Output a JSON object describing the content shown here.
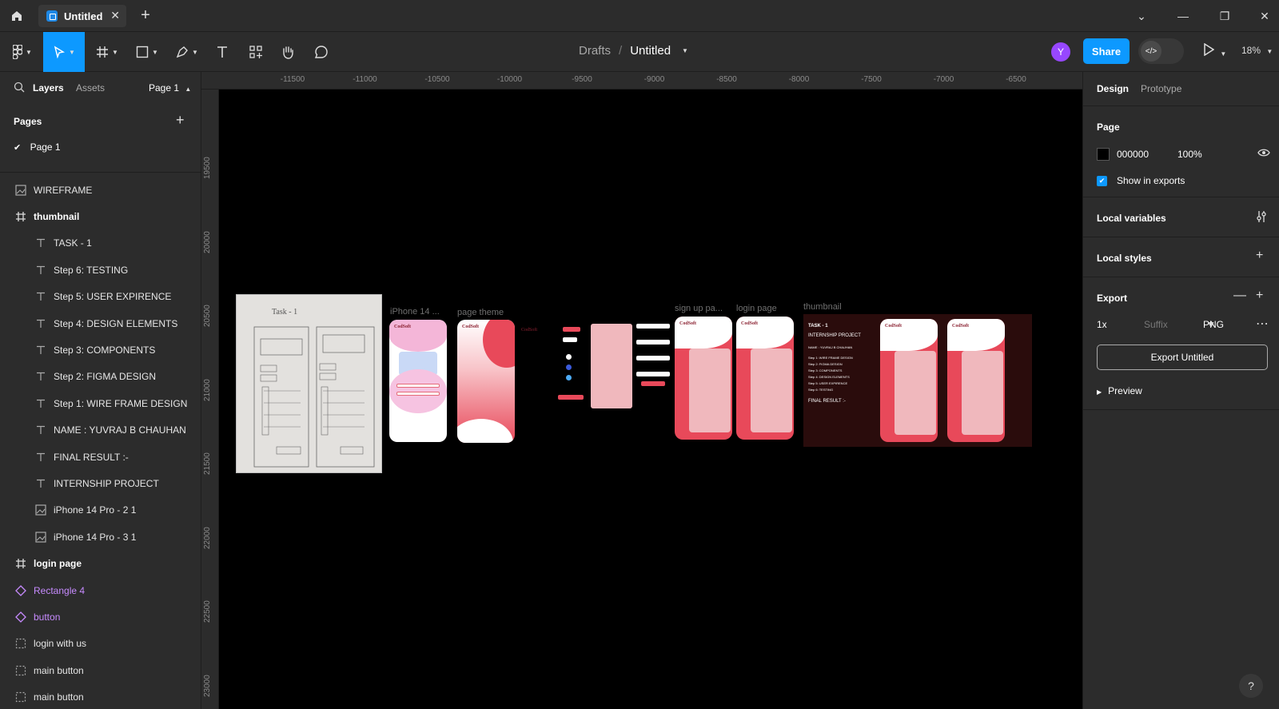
{
  "window": {
    "tab_title": "Untitled",
    "tab_close": "✕",
    "new_tab": "+",
    "controls": [
      "⌄",
      "—",
      "❐",
      "✕"
    ]
  },
  "toolbar": {
    "breadcrumb_parent": "Drafts",
    "breadcrumb_sep": "/",
    "file_name": "Untitled",
    "avatar_letter": "Y",
    "share_label": "Share",
    "zoom_label": "18%",
    "accent": "#0d99ff"
  },
  "left_panel": {
    "tab_layers": "Layers",
    "tab_assets": "Assets",
    "page_selector": "Page 1",
    "pages_heading": "Pages",
    "pages_add": "+",
    "current_page": "Page 1",
    "layers": [
      {
        "label": "WIREFRAME",
        "icon": "image-icon",
        "level": 0,
        "kind": "image"
      },
      {
        "label": "thumbnail",
        "icon": "frame-icon",
        "level": 0,
        "kind": "frame"
      },
      {
        "label": "TASK - 1",
        "icon": "text-icon",
        "level": 1,
        "kind": "text"
      },
      {
        "label": "Step 6: TESTING",
        "icon": "text-icon",
        "level": 1,
        "kind": "text"
      },
      {
        "label": "Step 5: USER EXPIRENCE",
        "icon": "text-icon",
        "level": 1,
        "kind": "text"
      },
      {
        "label": "Step 4: DESIGN ELEMENTS",
        "icon": "text-icon",
        "level": 1,
        "kind": "text"
      },
      {
        "label": "Step 3: COMPONENTS",
        "icon": "text-icon",
        "level": 1,
        "kind": "text"
      },
      {
        "label": "Step 2: FIGMA DESIGN",
        "icon": "text-icon",
        "level": 1,
        "kind": "text"
      },
      {
        "label": "Step 1: WIRE FRAME DESIGN",
        "icon": "text-icon",
        "level": 1,
        "kind": "text"
      },
      {
        "label": "NAME : YUVRAJ B CHAUHAN",
        "icon": "text-icon",
        "level": 1,
        "kind": "text"
      },
      {
        "label": "FINAL RESULT :-",
        "icon": "text-icon",
        "level": 1,
        "kind": "text"
      },
      {
        "label": "INTERNSHIP PROJECT",
        "icon": "text-icon",
        "level": 1,
        "kind": "text"
      },
      {
        "label": "iPhone 14 Pro - 2 1",
        "icon": "image-icon",
        "level": 1,
        "kind": "image"
      },
      {
        "label": "iPhone 14 Pro - 3 1",
        "icon": "image-icon",
        "level": 1,
        "kind": "image"
      },
      {
        "label": "login page",
        "icon": "frame-icon",
        "level": 0,
        "kind": "frame"
      },
      {
        "label": "Rectangle 4",
        "icon": "component-icon",
        "level": 0,
        "kind": "comp"
      },
      {
        "label": "button",
        "icon": "component-icon",
        "level": 0,
        "kind": "comp"
      },
      {
        "label": "login with us",
        "icon": "group-icon",
        "level": 0,
        "kind": "group"
      },
      {
        "label": "main button",
        "icon": "group-icon",
        "level": 0,
        "kind": "group"
      },
      {
        "label": "main button",
        "icon": "group-icon",
        "level": 0,
        "kind": "group"
      }
    ]
  },
  "rulers": {
    "top": [
      "-11500",
      "-11000",
      "-10500",
      "-10000",
      "-9500",
      "-9000",
      "-8500",
      "-8000",
      "-7500",
      "-7000",
      "-6500"
    ],
    "left": [
      "19500",
      "20000",
      "20500",
      "21000",
      "21500",
      "22000",
      "22500",
      "23000"
    ]
  },
  "canvas": {
    "frame_labels": {
      "iphone": "iPhone 14 ...",
      "theme": "page theme",
      "signup": "sign up pa...",
      "login": "login page",
      "thumbnail": "thumbnail"
    },
    "brand": "CodSoft",
    "thumbnail_title": "TASK - 1",
    "thumbnail_subtitle": "INTERNSHIP PROJECT",
    "thumbnail_name": "NAME : YUVRAJ B CHAUHAN",
    "thumbnail_steps": [
      "Step 1: WIRE FRAME DESIGN",
      "Step 2: FIGMA DESIGN",
      "Step 3: COMPONENTS",
      "Step 4: DESIGN ELEMENTS",
      "Step 5: USER EXPIRENCE",
      "Step 6: TESTING"
    ],
    "thumbnail_final": "FINAL RESULT :-",
    "wire_title": "Task - 1"
  },
  "right_panel": {
    "tab_design": "Design",
    "tab_prototype": "Prototype",
    "page_heading": "Page",
    "page_color": "000000",
    "page_opacity": "100%",
    "show_in_exports": "Show in exports",
    "local_variables": "Local variables",
    "local_styles": "Local styles",
    "export_heading": "Export",
    "export_scale": "1x",
    "export_suffix": "Suffix",
    "export_format": "PNG",
    "export_button": "Export Untitled",
    "preview": "Preview"
  },
  "help": "?"
}
